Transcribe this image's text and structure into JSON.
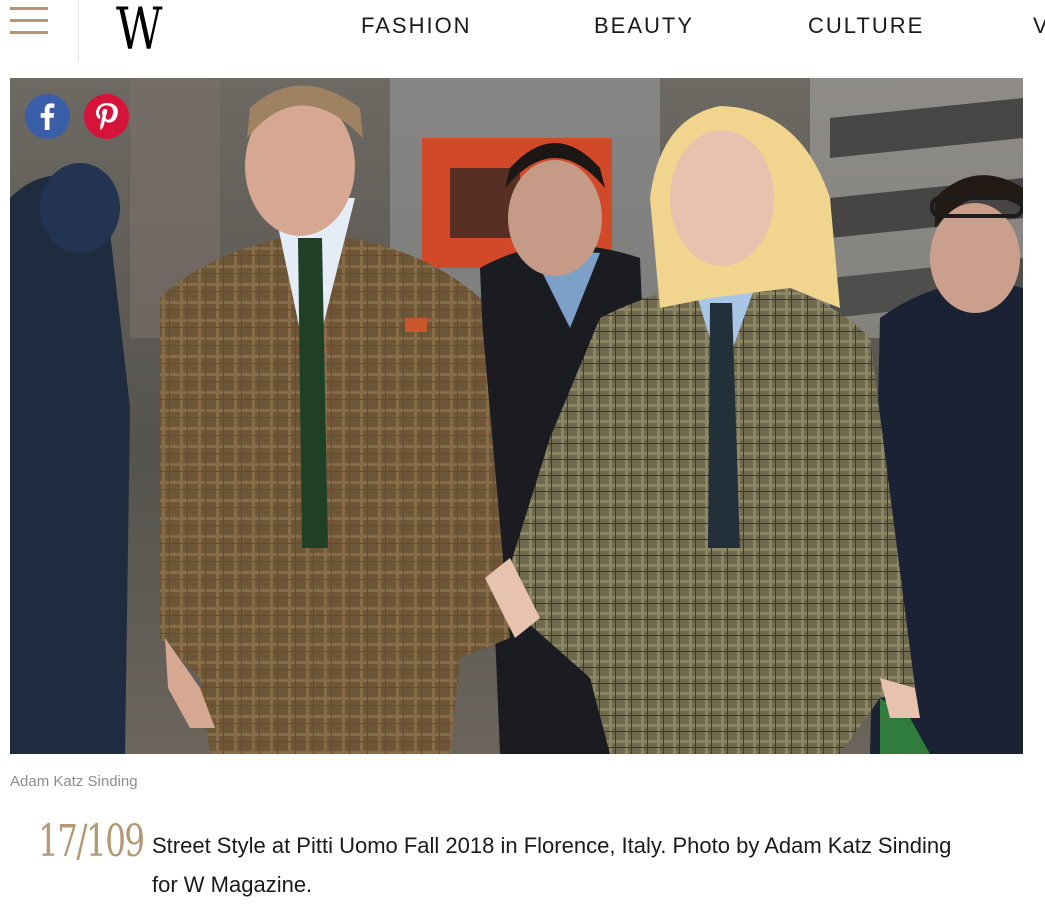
{
  "header": {
    "logo": "W",
    "nav": [
      "FASHION",
      "BEAUTY",
      "CULTURE",
      "V"
    ]
  },
  "icons": {
    "menu": "hamburger-menu-icon",
    "facebook": "facebook-icon",
    "pinterest": "pinterest-icon"
  },
  "colors": {
    "accent": "#b39872",
    "facebook": "#3b5ea8",
    "pinterest": "#d6143a"
  },
  "slide": {
    "photo_credit": "Adam Katz Sinding",
    "counter": "17/109",
    "caption": "Street Style at Pitti Uomo Fall 2018 in Florence, Italy. Photo by Adam Katz Sinding for W Magazine."
  }
}
